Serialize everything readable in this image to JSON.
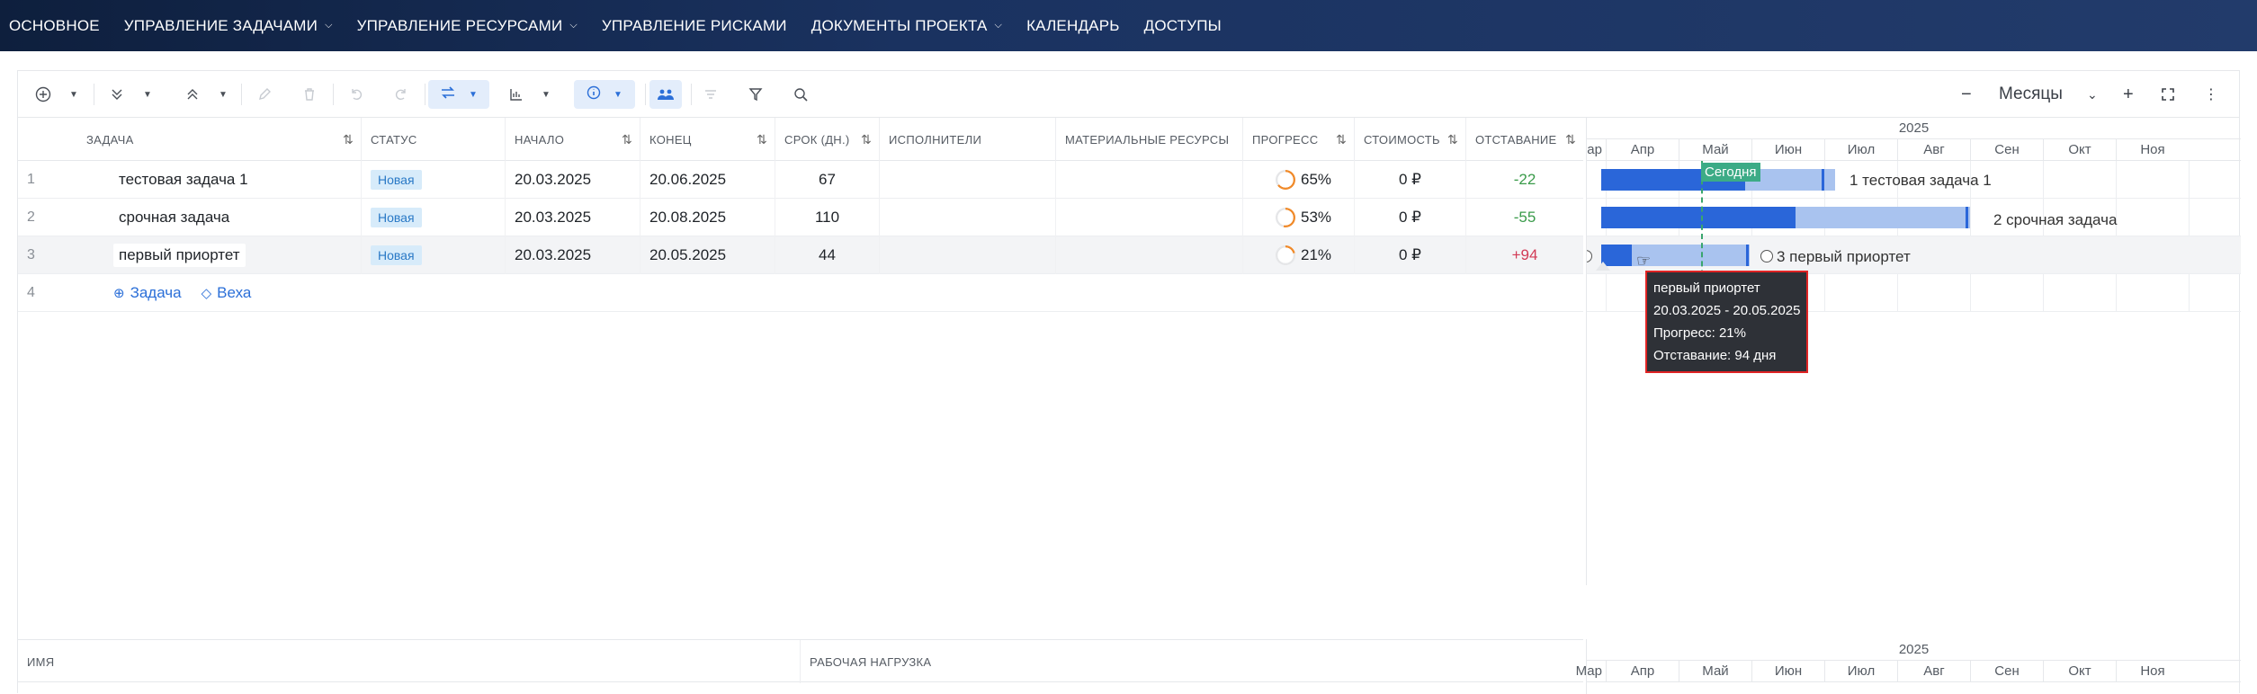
{
  "nav": {
    "items": [
      {
        "label": "ОСНОВНОЕ",
        "dropdown": false
      },
      {
        "label": "УПРАВЛЕНИЕ ЗАДАЧАМИ",
        "dropdown": true
      },
      {
        "label": "УПРАВЛЕНИЕ РЕСУРСАМИ",
        "dropdown": true
      },
      {
        "label": "УПРАВЛЕНИЕ РИСКАМИ",
        "dropdown": false
      },
      {
        "label": "ДОКУМЕНТЫ ПРОЕКТА",
        "dropdown": true
      },
      {
        "label": "КАЛЕНДАРЬ",
        "dropdown": false
      },
      {
        "label": "ДОСТУПЫ",
        "dropdown": false
      }
    ]
  },
  "toolbar": {
    "scale_label": "Месяцы",
    "icons": [
      "add-circle-icon",
      "expand-all-icon",
      "collapse-all-icon",
      "edit-icon",
      "delete-icon",
      "undo-icon",
      "redo-icon",
      "link-toggle-icon",
      "chart-icon",
      "info-icon",
      "resources-icon",
      "sort-icon",
      "filter-icon",
      "search-icon",
      "zoom-out-icon",
      "zoom-in-icon",
      "fullscreen-icon",
      "more-icon"
    ]
  },
  "grid": {
    "headers": {
      "task": "ЗАДАЧА",
      "status": "СТАТУС",
      "start": "НАЧАЛО",
      "end": "КОНЕЦ",
      "duration": "СРОК (ДН.)",
      "assignees": "ИСПОЛНИТЕЛИ",
      "materials": "МАТЕРИАЛЬНЫЕ РЕСУРСЫ",
      "progress": "ПРОГРЕСС",
      "cost": "СТОИМОСТЬ",
      "lag": "ОТСТАВАНИЕ"
    },
    "rows": [
      {
        "num": "1",
        "task": "тестовая задача 1",
        "status": "Новая",
        "start": "20.03.2025",
        "end": "20.06.2025",
        "duration": "67",
        "progress": "65%",
        "progress_value": 0.65,
        "cost": "0 ₽",
        "lag": "-22"
      },
      {
        "num": "2",
        "task": "срочная задача",
        "status": "Новая",
        "start": "20.03.2025",
        "end": "20.08.2025",
        "duration": "110",
        "progress": "53%",
        "progress_value": 0.53,
        "cost": "0 ₽",
        "lag": "-55"
      },
      {
        "num": "3",
        "task": "первый приортет",
        "status": "Новая",
        "start": "20.03.2025",
        "end": "20.05.2025",
        "duration": "44",
        "progress": "21%",
        "progress_value": 0.21,
        "cost": "0 ₽",
        "lag": "+94"
      }
    ],
    "add_row": {
      "num": "4",
      "add_task": "Задача",
      "add_milestone": "Веха"
    }
  },
  "gantt": {
    "year": "2025",
    "months": [
      "Мар",
      "Апр",
      "Май",
      "Июн",
      "Июл",
      "Авг",
      "Сен",
      "Окт",
      "Ноя"
    ],
    "today_label": "Сегодня",
    "bar_labels": [
      "1 тестовая задача 1",
      "2 срочная задача",
      "3 первый приортет"
    ],
    "tooltip": {
      "title": "первый приортет",
      "dates": "20.03.2025 - 20.05.2025",
      "progress": "Прогресс: 21%",
      "lag": "Отставание: 94 дня"
    }
  },
  "resources": {
    "headers": {
      "name": "ИМЯ",
      "workload": "РАБОЧАЯ НАГРУЗКА"
    },
    "year": "2025",
    "months": [
      "Мар",
      "Апр",
      "Май",
      "Июн",
      "Июл",
      "Авг",
      "Сен",
      "Окт",
      "Ноя"
    ]
  },
  "colors": {
    "accent": "#2b6fd8",
    "bar_done": "#2a66d9",
    "bar_remaining": "#a9c3ef",
    "today": "#3cab86",
    "status_badge": "#d7ebfa",
    "lag_negative": "#3a9b4a",
    "lag_positive": "#d23a55",
    "tooltip_border": "#e02424",
    "progress_ring": "#f08a2a"
  }
}
